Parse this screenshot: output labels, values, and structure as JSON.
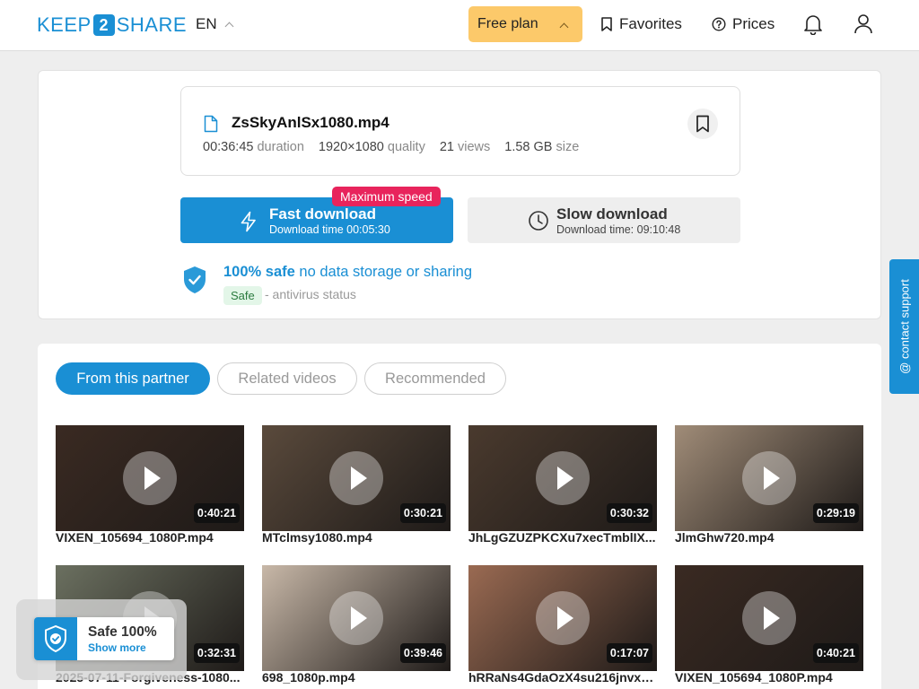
{
  "header": {
    "logo_left": "KEEP",
    "logo_mid": "2",
    "logo_right": "SHARE",
    "language": "EN",
    "plan_label": "Free plan",
    "favorites_label": "Favorites",
    "prices_label": "Prices"
  },
  "file": {
    "name": "ZsSkyAnlSx1080.mp4",
    "duration_value": "00:36:45",
    "duration_label": "duration",
    "quality_value": "1920×1080",
    "quality_label": "quality",
    "views_value": "21",
    "views_label": "views",
    "size_value": "1.58 GB",
    "size_label": "size"
  },
  "download": {
    "fast_title": "Fast download",
    "fast_time": "Download time 00:05:30",
    "max_speed_badge": "Maximum speed",
    "slow_title": "Slow download",
    "slow_time": "Download time: 09:10:48"
  },
  "safety": {
    "strong": "100% safe",
    "rest": "no data storage or sharing",
    "tag": "Safe",
    "status": "- antivirus status"
  },
  "tabs": [
    {
      "label": "From this partner"
    },
    {
      "label": "Related videos"
    },
    {
      "label": "Recommended"
    }
  ],
  "videos": [
    {
      "title": "VIXEN_105694_1080P.mp4",
      "duration": "0:40:21",
      "bg": "#3a2a22"
    },
    {
      "title": "MTclmsy1080.mp4",
      "duration": "0:30:21",
      "bg": "#5a4a3c"
    },
    {
      "title": "JhLgGZUZPKCXu7xecTmblIX...",
      "duration": "0:30:32",
      "bg": "#4a3a2e"
    },
    {
      "title": "JlmGhw720.mp4",
      "duration": "0:29:19",
      "bg": "#a08c78"
    },
    {
      "title": "2025-07-11-Forgiveness-1080...",
      "duration": "0:32:31",
      "bg": "#6b7060"
    },
    {
      "title": "698_1080p.mp4",
      "duration": "0:39:46",
      "bg": "#c8b8a8"
    },
    {
      "title": "hRRaNs4GdaOzX4su216jnvxa...",
      "duration": "0:17:07",
      "bg": "#9a6a52"
    },
    {
      "title": "VIXEN_105694_1080P.mp4",
      "duration": "0:40:21",
      "bg": "#3a2a22"
    }
  ],
  "contact_label": "@ contact support",
  "safe_widget": {
    "title": "Safe 100%",
    "link": "Show more"
  },
  "colors": {
    "accent": "#1a8fd4",
    "plan": "#fcc96a",
    "badge": "#e8245c"
  }
}
